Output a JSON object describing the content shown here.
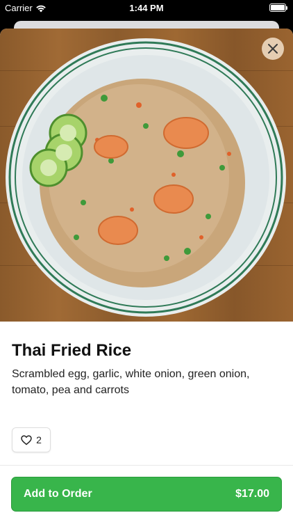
{
  "status_bar": {
    "carrier": "Carrier",
    "time": "1:44 PM"
  },
  "item": {
    "name": "Thai Fried Rice",
    "description": "Scrambled egg, garlic, white onion, green onion, tomato, pea and carrots",
    "likes": "2"
  },
  "order_button": {
    "label": "Add to Order",
    "price": "$17.00",
    "color": "#38b54b"
  },
  "icons": {
    "close": "close-icon",
    "heart": "heart-icon",
    "wifi": "wifi-icon",
    "battery": "battery-icon"
  }
}
